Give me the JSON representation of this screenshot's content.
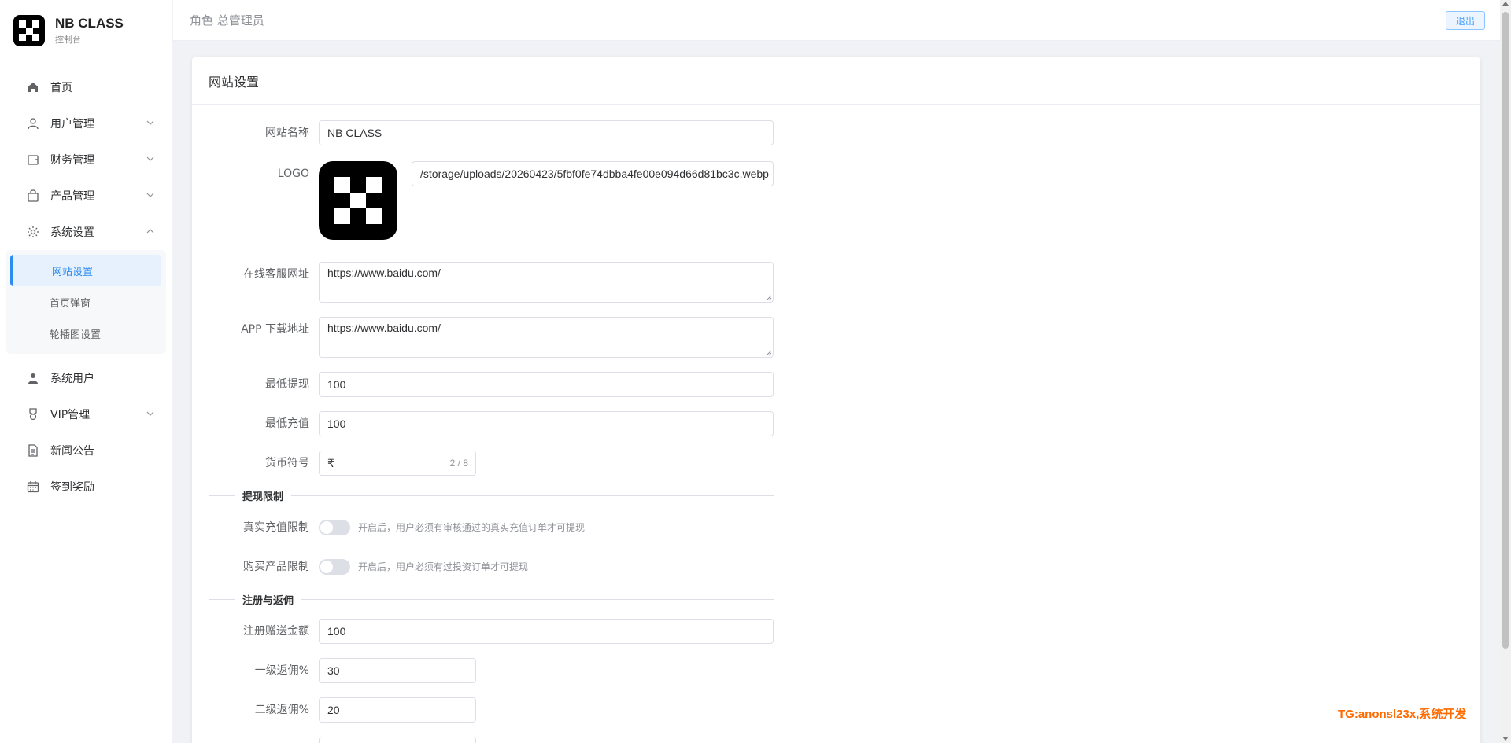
{
  "brand": {
    "name": "NB CLASS",
    "subtitle": "控制台"
  },
  "header": {
    "role": "角色 总管理员",
    "logout_label": "退出"
  },
  "sidebar": {
    "items": [
      {
        "label": "首页"
      },
      {
        "label": "用户管理"
      },
      {
        "label": "财务管理"
      },
      {
        "label": "产品管理"
      },
      {
        "label": "系统设置"
      },
      {
        "label": "系统用户"
      },
      {
        "label": "VIP管理"
      },
      {
        "label": "新闻公告"
      },
      {
        "label": "签到奖励"
      }
    ],
    "system_sub": [
      {
        "label": "网站设置"
      },
      {
        "label": "首页弹窗"
      },
      {
        "label": "轮播图设置"
      }
    ]
  },
  "card": {
    "title": "网站设置"
  },
  "form": {
    "site_name": {
      "label": "网站名称",
      "value": "NB CLASS"
    },
    "logo": {
      "label": "LOGO",
      "path": "/storage/uploads/20260423/5fbf0fe74dbba4fe00e094d66d81bc3c.webp"
    },
    "service_url": {
      "label": "在线客服网址",
      "value": "https://www.baidu.com/"
    },
    "app_url": {
      "label": "APP 下载地址",
      "value": "https://www.baidu.com/"
    },
    "min_withdraw": {
      "label": "最低提现",
      "value": "100"
    },
    "min_recharge": {
      "label": "最低充值",
      "value": "100"
    },
    "currency": {
      "label": "货币符号",
      "value": "₹",
      "count": "2 / 8"
    },
    "section_withdraw": "提现限制",
    "real_recharge": {
      "label": "真实充值限制",
      "hint": "开启后，用户必须有审核通过的真实充值订单才可提现",
      "enabled": false
    },
    "buy_product": {
      "label": "购买产品限制",
      "hint": "开启后，用户必须有过投资订单才可提现",
      "enabled": false
    },
    "section_register": "注册与返佣",
    "register_bonus": {
      "label": "注册赠送金额",
      "value": "100"
    },
    "rebate_1": {
      "label": "一级返佣%",
      "value": "30"
    },
    "rebate_2": {
      "label": "二级返佣%",
      "value": "20"
    }
  },
  "watermark": "TG:anonsl23x,系统开发"
}
